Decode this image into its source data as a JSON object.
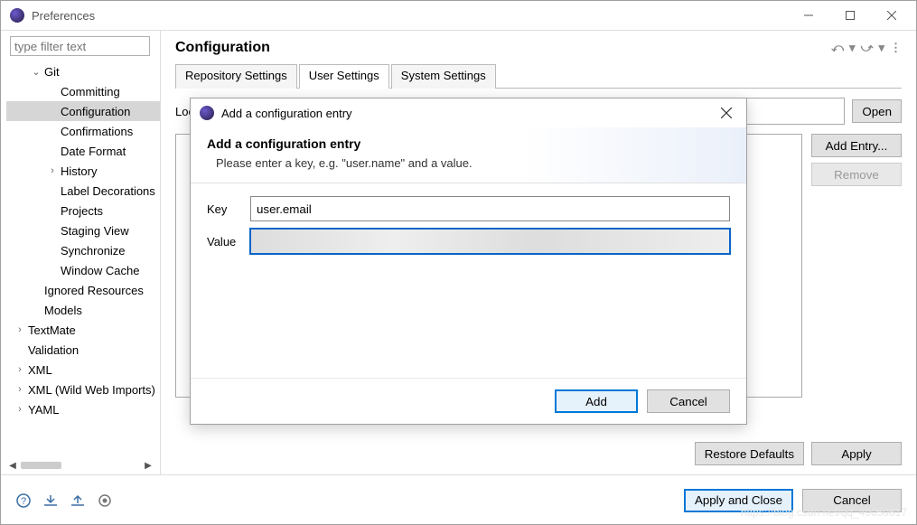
{
  "window": {
    "title": "Preferences"
  },
  "sidebar": {
    "filter_placeholder": "type filter text",
    "items": [
      {
        "label": "Git",
        "depth": 1,
        "exp": "open"
      },
      {
        "label": "Committing",
        "depth": 2
      },
      {
        "label": "Configuration",
        "depth": 2,
        "selected": true
      },
      {
        "label": "Confirmations",
        "depth": 2
      },
      {
        "label": "Date Format",
        "depth": 2
      },
      {
        "label": "History",
        "depth": 2,
        "exp": "closed"
      },
      {
        "label": "Label Decorations",
        "depth": 2
      },
      {
        "label": "Projects",
        "depth": 2
      },
      {
        "label": "Staging View",
        "depth": 2
      },
      {
        "label": "Synchronize",
        "depth": 2
      },
      {
        "label": "Window Cache",
        "depth": 2
      },
      {
        "label": "Ignored Resources",
        "depth": 1
      },
      {
        "label": "Models",
        "depth": 1
      },
      {
        "label": "TextMate",
        "depth": 0,
        "exp": "closed"
      },
      {
        "label": "Validation",
        "depth": 0
      },
      {
        "label": "XML",
        "depth": 0,
        "exp": "closed"
      },
      {
        "label": "XML (Wild Web Imports)",
        "depth": 0,
        "exp": "closed"
      },
      {
        "label": "YAML",
        "depth": 0,
        "exp": "closed"
      }
    ]
  },
  "page": {
    "heading": "Configuration",
    "tabs": [
      "Repository Settings",
      "User Settings",
      "System Settings"
    ],
    "active_tab": 1,
    "location_label": "Location:",
    "location_value": "",
    "open_label": "Open",
    "add_entry_label": "Add Entry...",
    "remove_label": "Remove",
    "restore_label": "Restore Defaults",
    "apply_label": "Apply"
  },
  "footer": {
    "apply_close": "Apply and Close",
    "cancel": "Cancel"
  },
  "dialog": {
    "title": "Add a configuration entry",
    "heading": "Add a configuration entry",
    "message": "Please enter a key, e.g. \"user.name\" and a value.",
    "key_label": "Key",
    "key_value": "user.email",
    "value_label": "Value",
    "value_value": "",
    "add": "Add",
    "cancel": "Cancel"
  },
  "watermark": "https://blog.csdn.net/qq_49050617"
}
